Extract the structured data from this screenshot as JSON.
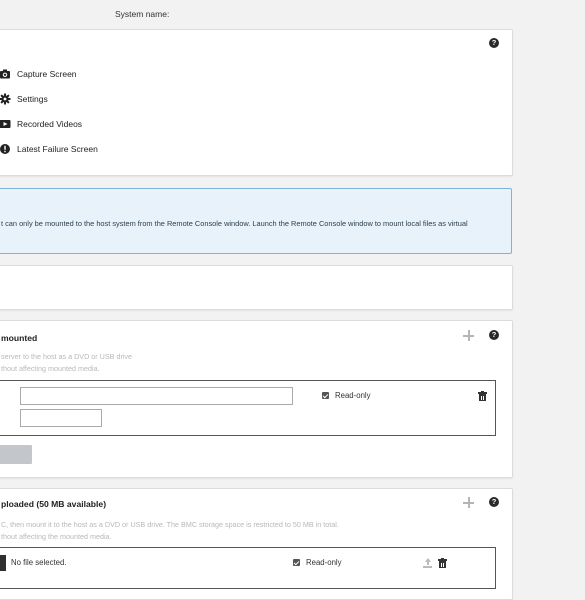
{
  "header": {
    "system_name_label": "System name:"
  },
  "actions_panel": {
    "help": "?",
    "items": [
      {
        "label": "Capture Screen",
        "icon": "camera-icon"
      },
      {
        "label": "Settings",
        "icon": "gear-icon"
      },
      {
        "label": "Recorded Videos",
        "icon": "video-icon"
      },
      {
        "label": "Latest Failure Screen",
        "icon": "alert-icon"
      }
    ]
  },
  "info_box": {
    "text": "t can only be mounted to the host system from the Remote Console window. Launch the Remote Console window to mount local files as virtual"
  },
  "mounted_panel": {
    "title": "mounted",
    "help": "?",
    "desc_line1": "server to the host as a DVD or USB drive",
    "desc_line2": "thout affecting mounted media.",
    "url_input_value": "",
    "second_input_value": "",
    "readonly_label": "Read-only",
    "readonly_checked": true
  },
  "uploaded_panel": {
    "title": "ploaded (50 MB available)",
    "help": "?",
    "desc_line1": "C, then mount it to the host as a DVD or USB drive. The BMC storage space is restricted to 50 MB in total.",
    "desc_line2": "thout affecting the mounted media.",
    "file_status": "No file selected.",
    "readonly_label": "Read-only",
    "readonly_checked": true
  },
  "colors": {
    "info_bg": "#e7f2fa",
    "info_border": "#7fb3d8",
    "page_bg": "#f2f2f2"
  }
}
